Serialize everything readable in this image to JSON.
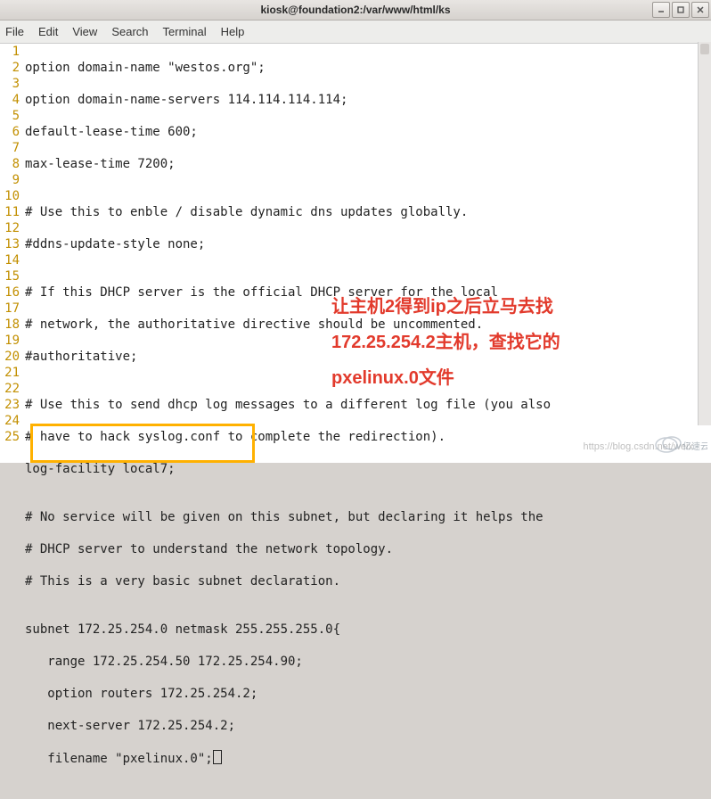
{
  "window": {
    "title": "kiosk@foundation2:/var/www/html/ks"
  },
  "menubar": {
    "file": "File",
    "edit": "Edit",
    "view": "View",
    "search": "Search",
    "terminal": "Terminal",
    "help": "Help"
  },
  "gutter": [
    "1",
    "2",
    "3",
    "4",
    "5",
    "6",
    "7",
    "8",
    "9",
    "10",
    "11",
    "12",
    "13",
    "14",
    "15",
    "16",
    "17",
    "18",
    "19",
    "20",
    "21",
    "22",
    "23",
    "24",
    "25"
  ],
  "code": {
    "l1": "option domain-name \"westos.org\";",
    "l2": "option domain-name-servers 114.114.114.114;",
    "l3": "default-lease-time 600;",
    "l4": "max-lease-time 7200;",
    "l5": "",
    "l6": "# Use this to enble / disable dynamic dns updates globally.",
    "l7": "#ddns-update-style none;",
    "l8": "",
    "l9": "# If this DHCP server is the official DHCP server for the local",
    "l10": "# network, the authoritative directive should be uncommented.",
    "l11": "#authoritative;",
    "l12": "",
    "l13": "# Use this to send dhcp log messages to a different log file (you also",
    "l14": "# have to hack syslog.conf to complete the redirection).",
    "l15": "log-facility local7;",
    "l16": "",
    "l17": "# No service will be given on this subnet, but declaring it helps the",
    "l18": "# DHCP server to understand the network topology.",
    "l19": "# This is a very basic subnet declaration.",
    "l20": "",
    "l21": "subnet 172.25.254.0 netmask 255.255.255.0{",
    "l22": "   range 172.25.254.50 172.25.254.90;",
    "l23": "   option routers 172.25.254.2;",
    "l24": "   next-server 172.25.254.2;",
    "l25": "   filename \"pxelinux.0\";"
  },
  "annotation": {
    "line1": "让主机2得到ip之后立马去找",
    "line2": "172.25.254.2主机，查找它的",
    "line3": "pxelinux.0文件"
  },
  "watermark": "https://blog.csdn.net/weix",
  "logo_text": "亿速云"
}
